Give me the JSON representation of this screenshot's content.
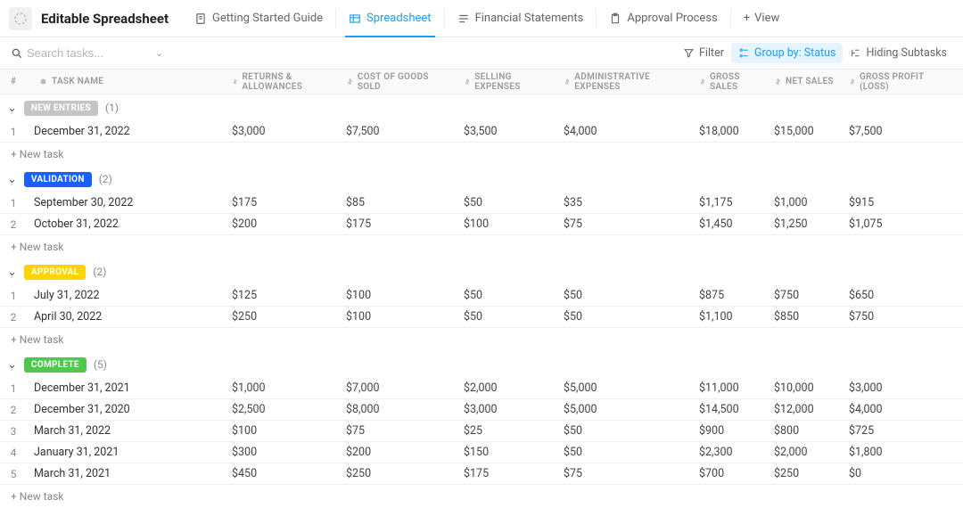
{
  "header": {
    "title": "Editable Spreadsheet",
    "tabs": [
      {
        "label": "Getting Started Guide",
        "active": false
      },
      {
        "label": "Spreadsheet",
        "active": true
      },
      {
        "label": "Financial Statements",
        "active": false
      },
      {
        "label": "Approval Process",
        "active": false
      }
    ],
    "add_view": "View"
  },
  "toolbar": {
    "search_placeholder": "Search tasks...",
    "filter": "Filter",
    "group_by": "Group by: Status",
    "hiding_subtasks": "Hiding Subtasks"
  },
  "columns": {
    "num": "#",
    "name": "TASK NAME",
    "returns": "RETURNS & ALLOWANCES",
    "cogs": "COST OF GOODS SOLD",
    "selling": "SELLING EXPENSES",
    "admin": "ADMINISTRATIVE EXPENSES",
    "gross": "GROSS SALES",
    "net": "NET SALES",
    "profit": "GROSS PROFIT (LOSS)"
  },
  "groups": [
    {
      "status": "NEW ENTRIES",
      "pill": "pill-gray",
      "count": "(1)",
      "rows": [
        {
          "n": "1",
          "name": "December 31, 2022",
          "returns": "$3,000",
          "cogs": "$7,500",
          "selling": "$3,500",
          "admin": "$4,000",
          "gross": "$18,000",
          "net": "$15,000",
          "profit": "$7,500"
        }
      ]
    },
    {
      "status": "VALIDATION",
      "pill": "pill-blue",
      "count": "(2)",
      "rows": [
        {
          "n": "1",
          "name": "September 30, 2022",
          "returns": "$175",
          "cogs": "$85",
          "selling": "$50",
          "admin": "$35",
          "gross": "$1,175",
          "net": "$1,000",
          "profit": "$915"
        },
        {
          "n": "2",
          "name": "October 31, 2022",
          "returns": "$200",
          "cogs": "$175",
          "selling": "$100",
          "admin": "$75",
          "gross": "$1,450",
          "net": "$1,250",
          "profit": "$1,075"
        }
      ]
    },
    {
      "status": "APPROVAL",
      "pill": "pill-yellow",
      "count": "(2)",
      "rows": [
        {
          "n": "1",
          "name": "July 31, 2022",
          "returns": "$125",
          "cogs": "$100",
          "selling": "$50",
          "admin": "$50",
          "gross": "$875",
          "net": "$750",
          "profit": "$650"
        },
        {
          "n": "2",
          "name": "April 30, 2022",
          "returns": "$250",
          "cogs": "$100",
          "selling": "$50",
          "admin": "$50",
          "gross": "$1,100",
          "net": "$850",
          "profit": "$750"
        }
      ]
    },
    {
      "status": "COMPLETE",
      "pill": "pill-green",
      "count": "(5)",
      "rows": [
        {
          "n": "1",
          "name": "December 31, 2021",
          "returns": "$1,000",
          "cogs": "$7,000",
          "selling": "$2,000",
          "admin": "$5,000",
          "gross": "$11,000",
          "net": "$10,000",
          "profit": "$3,000"
        },
        {
          "n": "2",
          "name": "December 31, 2020",
          "returns": "$2,500",
          "cogs": "$8,000",
          "selling": "$3,000",
          "admin": "$5,000",
          "gross": "$14,500",
          "net": "$12,000",
          "profit": "$4,000"
        },
        {
          "n": "3",
          "name": "March 31, 2022",
          "returns": "$100",
          "cogs": "$75",
          "selling": "$25",
          "admin": "$50",
          "gross": "$900",
          "net": "$800",
          "profit": "$725"
        },
        {
          "n": "4",
          "name": "January 31, 2021",
          "returns": "$300",
          "cogs": "$200",
          "selling": "$150",
          "admin": "$50",
          "gross": "$2,300",
          "net": "$2,000",
          "profit": "$1,800"
        },
        {
          "n": "5",
          "name": "March 31, 2021",
          "returns": "$450",
          "cogs": "$250",
          "selling": "$175",
          "admin": "$75",
          "gross": "$700",
          "net": "$250",
          "profit": "$0"
        }
      ]
    }
  ],
  "labels": {
    "new_task": "+ New task",
    "plus": "+"
  }
}
